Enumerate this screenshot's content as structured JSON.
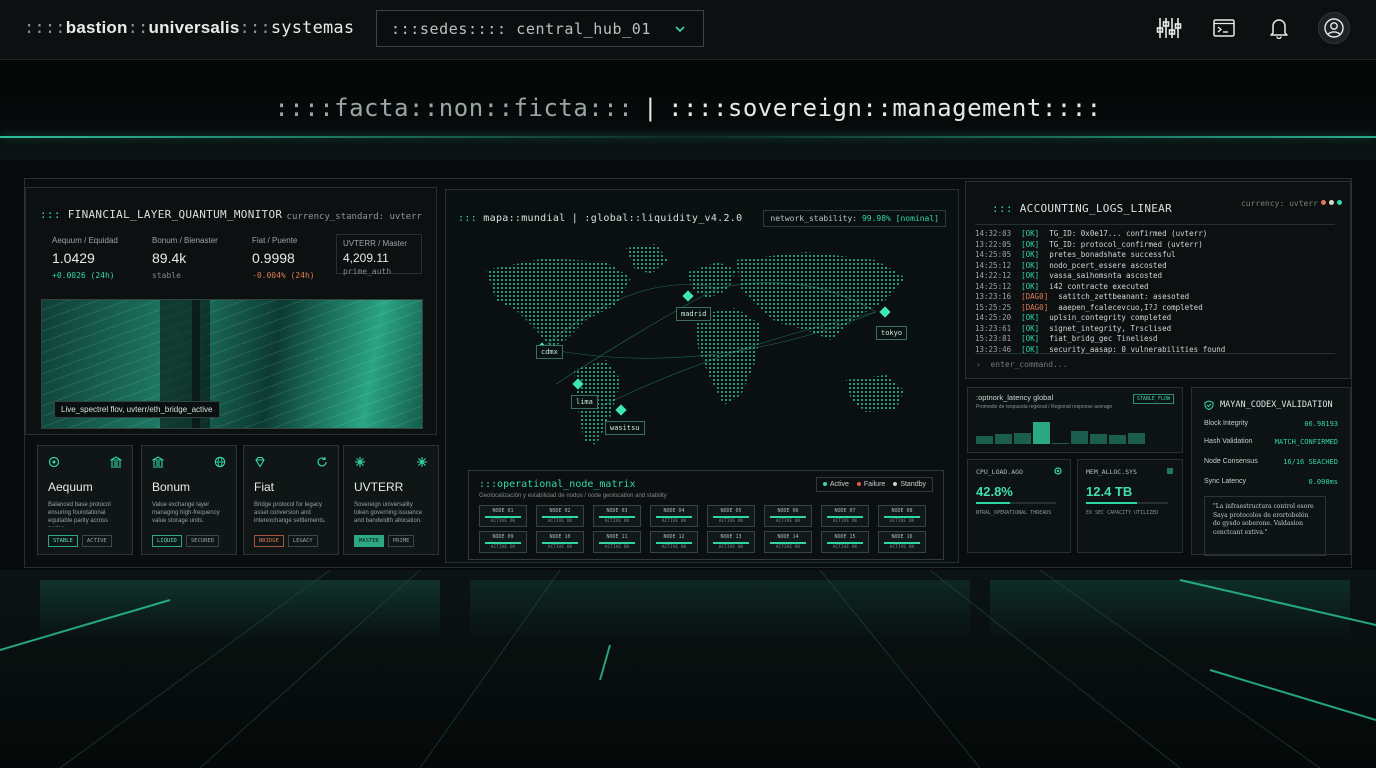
{
  "topbar": {
    "brand_prefix": "::::",
    "brand_a": "bastion",
    "brand_sep": "::",
    "brand_b": "universalis",
    "brand_sep2": ":::",
    "brand_c": "systemas",
    "site_select": ":::sedes:::: central_hub_01",
    "icons": [
      "equalizer-icon",
      "terminal-icon",
      "bell-icon",
      "user-avatar-icon"
    ]
  },
  "hero": {
    "motto_left": "::::facta::non::ficta:::",
    "motto_divider": "|",
    "motto_right": "::::sovereign::management::::"
  },
  "financial": {
    "title": "FINANCIAL_LAYER_QUANTUM_MONITOR",
    "prefix": ":::",
    "standard": "currency_standard: uvterr",
    "metrics": [
      {
        "label": "Aequum / Equidad",
        "value": "1.0429",
        "sub": "+0.0026 (24h)",
        "tone": "teal"
      },
      {
        "label": "Bonum / Bienaster",
        "value": "89.4k",
        "sub": "stable",
        "tone": "dim"
      },
      {
        "label": "Fiat / Puente",
        "value": "0.9998",
        "sub": "-0.004% (24h)",
        "tone": "red"
      },
      {
        "label": "UVTERR / Master",
        "value": "4,209.11",
        "sub": "prime_auth",
        "tone": "teal"
      }
    ],
    "stream_caption": "Live_spectrel flov, uvterr/eth_bridge_active",
    "cards": [
      {
        "name": "Aequum",
        "desc": "Balanced base protocol ensuring foundational equitable parity across nodes.",
        "tags": [
          "STABLE",
          "ACTIVE"
        ]
      },
      {
        "name": "Bonum",
        "desc": "Value exchange layer managing high-frequency value storage units.",
        "tags": [
          "LIQUID",
          "SECURED"
        ]
      },
      {
        "name": "Fiat",
        "desc": "Bridge protocol for legacy asset conversion and interexchange settlements.",
        "tags": [
          "BRIDGE",
          "LEGACY"
        ]
      },
      {
        "name": "UVTERR",
        "desc": "Sovereign universality token governing issuance and bandwidth allocation.",
        "tags": [
          "MASTER",
          "PRIME"
        ]
      }
    ]
  },
  "map": {
    "title": "mapa::mundial | :global::liquidity_v4.2.0",
    "prefix": ":::",
    "stability_label": "network_stability:",
    "stability_value": "99.98% [nominal]",
    "nodes": [
      "cdmx",
      "lima",
      "wasitsu",
      "madrid",
      "tokyo"
    ],
    "matrix_title": ":::operational_node_matrix",
    "matrix_sub": "Geolocalización y estabilidad de nodos / node geolocation and stability",
    "legend": [
      "Active",
      "Failure",
      "Standby"
    ],
    "cells": [
      {
        "id": "NODE 01",
        "state": "ACTIVE OK"
      },
      {
        "id": "NODE 02",
        "state": "ACTIVE OK"
      },
      {
        "id": "NODE 03",
        "state": "ACTIVE OK"
      },
      {
        "id": "NODE 04",
        "state": "ACTIVE OK"
      },
      {
        "id": "NODE 05",
        "state": "ACTIVE OK"
      },
      {
        "id": "NODE 06",
        "state": "ACTIVE OK"
      },
      {
        "id": "NODE 07",
        "state": "ACTIVE OK"
      },
      {
        "id": "NODE 08",
        "state": "ACTIVE OK"
      },
      {
        "id": "NODE 09",
        "state": "ACTIVE OK"
      },
      {
        "id": "NODE 10",
        "state": "ACTIVE OK"
      },
      {
        "id": "NODE 11",
        "state": "ACTIVE OK"
      },
      {
        "id": "NODE 12",
        "state": "ACTIVE OK"
      },
      {
        "id": "NODE 13",
        "state": "ACTIVE OK"
      },
      {
        "id": "NODE 14",
        "state": "ACTIVE OK"
      },
      {
        "id": "NODE 15",
        "state": "ACTIVE OK"
      },
      {
        "id": "NODE 16",
        "state": "ACTIVE OK"
      }
    ]
  },
  "logs": {
    "title": "ACCOUNTING_LOGS_LINEAR",
    "prefix": ":::",
    "currency": "currency: uvterr",
    "lines": [
      {
        "t": "14:32:03",
        "k": "[OK]",
        "m": "TG_ID: 0x0e17... confirmed (uvterr)"
      },
      {
        "t": "13:22:05",
        "k": "[OK]",
        "m": "TG_ID: protocol_confirmed (uvterr)"
      },
      {
        "t": "14:25:05",
        "k": "[OK]",
        "m": "pretes_bonadshate successful"
      },
      {
        "t": "14:25:12",
        "k": "[OK]",
        "m": "nodo_pcert_essere ascosted"
      },
      {
        "t": "14:22:12",
        "k": "[OK]",
        "m": "vassa_saihomsnta ascosted"
      },
      {
        "t": "14:25:12",
        "k": "[OK]",
        "m": "i42 contracte executed"
      },
      {
        "t": "13:23:16",
        "k": "[DAG0]",
        "m": "satitch_zettbeanant: asesoted"
      },
      {
        "t": "15:25:25",
        "k": "[DAG0]",
        "m": "aaepen_fcalecevcuo,I?J completed"
      },
      {
        "t": "14:25:20",
        "k": "[OK]",
        "m": "uplsin_contegrity completed"
      },
      {
        "t": "13:23:61",
        "k": "[OK]",
        "m": "signet_integrity, Trsclised"
      },
      {
        "t": "15:23:81",
        "k": "[OK]",
        "m": "fiat_bridg_gec Tineliesd"
      },
      {
        "t": "13:23:46",
        "k": "[OK]",
        "m": "security_aasap: 0 vulnerabilities found"
      }
    ],
    "prompt_symbol": "›",
    "prompt": "enter_command..."
  },
  "latency": {
    "title": ":optnork_latency global",
    "sub": "Promedio de respuesta regional / Regional response average",
    "badge": "STABLE_FLOW",
    "bars": [
      0.35,
      0.45,
      0.5,
      1.0,
      0.0,
      0.6,
      0.45,
      0.4,
      0.5
    ]
  },
  "cpu": {
    "label": "CPU_LOAD.AGO",
    "value": "42.8%",
    "fill": 0.43,
    "foot": "NTRAL_OPERATIONAL THREADS"
  },
  "mem": {
    "label": "MEM_ALLOC.SYS",
    "value": "12.4 TB",
    "fill": 0.62,
    "foot": "EX SEC CAPACITY UTILIZED"
  },
  "mayan": {
    "title": "MAYAN_CODEX_VALIDATION",
    "rows": [
      {
        "k": "Block Integrity",
        "v": "06.98193"
      },
      {
        "k": "Hash Validation",
        "v": "MATCH_CONFIRMED"
      },
      {
        "k": "Node Consensus",
        "v": "16/16 SEACHED"
      },
      {
        "k": "Sync Latency",
        "v": "0.008ms"
      }
    ],
    "quote": "\"La infraestructura control esore Saya protocolos de erortobelón de gysdo soberone. Valdasion cenctcant extiva.\""
  },
  "colors": {
    "accent": "#2ED6A4",
    "background": "#07090A",
    "panel": "#0C1011",
    "warning": "#E07A55"
  }
}
